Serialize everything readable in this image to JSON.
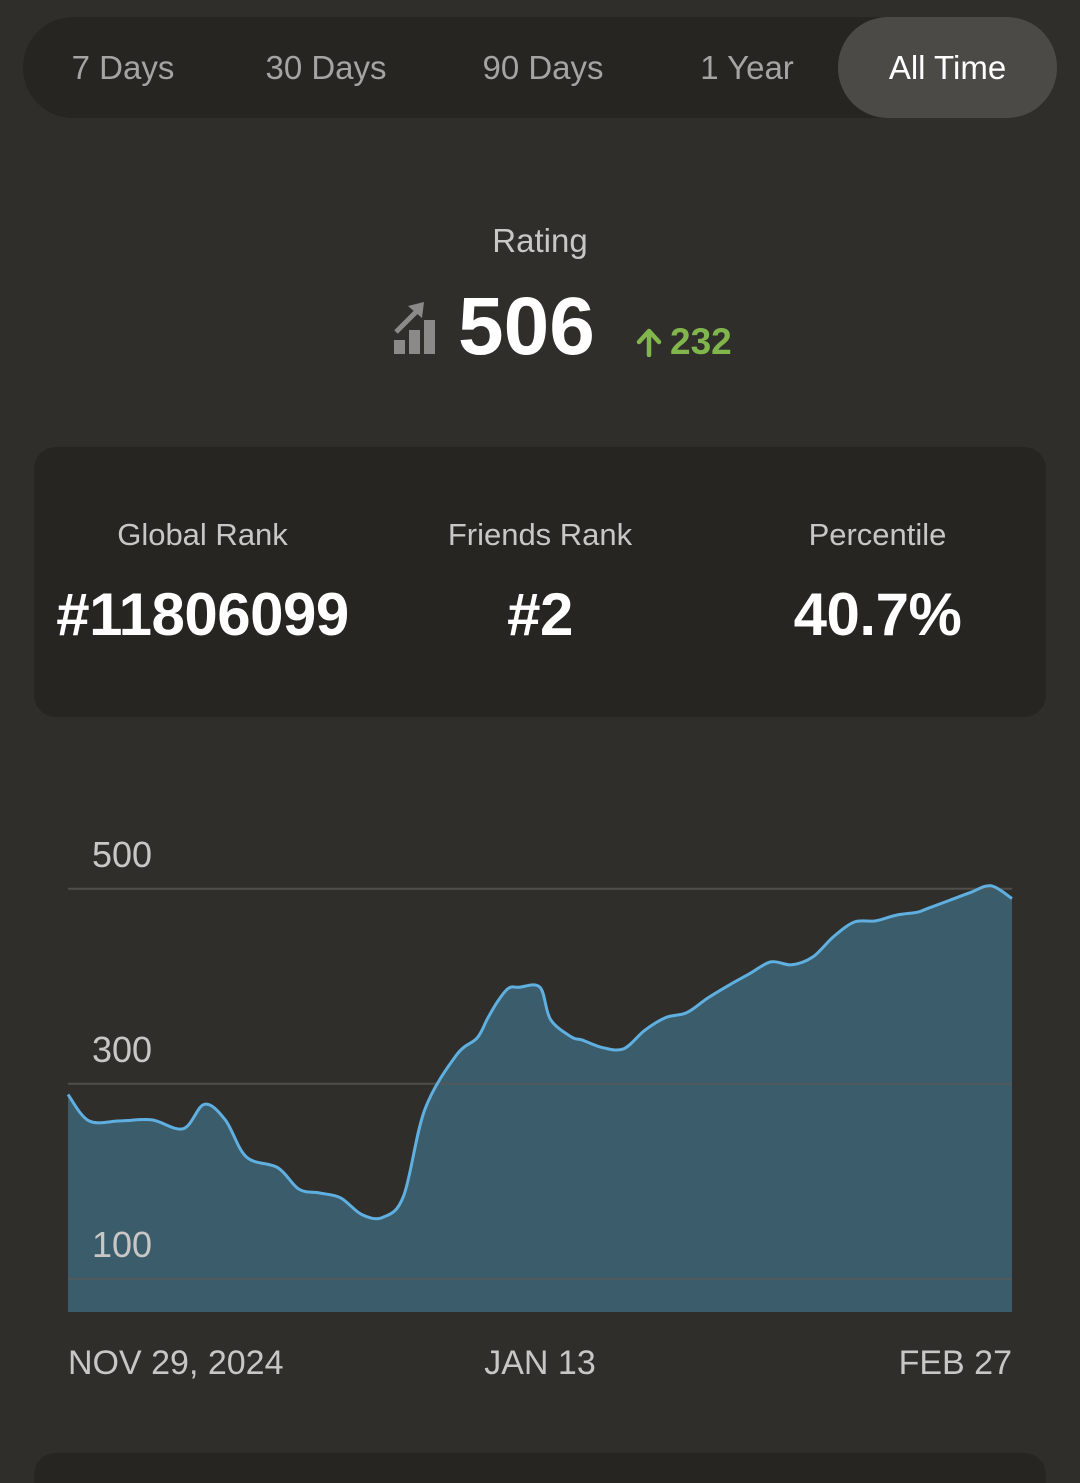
{
  "period_tabs": [
    {
      "label": "7 Days",
      "active": false
    },
    {
      "label": "30 Days",
      "active": false
    },
    {
      "label": "90 Days",
      "active": false
    },
    {
      "label": "1 Year",
      "active": false
    },
    {
      "label": "All Time",
      "active": true
    }
  ],
  "rating": {
    "label": "Rating",
    "value": "506",
    "change": "232",
    "change_direction": "up",
    "icon": "rating-chart-up-icon"
  },
  "stats": {
    "global_rank": {
      "label": "Global Rank",
      "value": "#11806099"
    },
    "friends_rank": {
      "label": "Friends Rank",
      "value": "#2"
    },
    "percentile": {
      "label": "Percentile",
      "value": "40.7%"
    }
  },
  "colors": {
    "background": "#302e2b",
    "card": "#262522",
    "active_tab": "#4b4a46",
    "positive": "#81b64c",
    "line": "#5fb0e0",
    "area": "#3b5c6b"
  },
  "chart_data": {
    "type": "area",
    "x_tick_labels": [
      "NOV 29, 2024",
      "JAN 13",
      "FEB 27"
    ],
    "y_ticks": [
      100,
      300,
      500
    ],
    "ylim": [
      66,
      510
    ],
    "grid": true,
    "x": [
      "2024-11-29",
      "2024-12-01",
      "2024-12-04",
      "2024-12-07",
      "2024-12-10",
      "2024-12-12",
      "2024-12-14",
      "2024-12-16",
      "2024-12-19",
      "2024-12-21",
      "2024-12-23",
      "2024-12-25",
      "2024-12-27",
      "2024-12-29",
      "2024-12-31",
      "2025-01-02",
      "2025-01-05",
      "2025-01-07",
      "2025-01-08",
      "2025-01-09",
      "2025-01-10",
      "2025-01-11",
      "2025-01-13",
      "2025-01-14",
      "2025-01-16",
      "2025-01-17",
      "2025-01-19",
      "2025-01-21",
      "2025-01-23",
      "2025-01-25",
      "2025-01-27",
      "2025-01-29",
      "2025-01-31",
      "2025-02-02",
      "2025-02-04",
      "2025-02-06",
      "2025-02-08",
      "2025-02-10",
      "2025-02-12",
      "2025-02-14",
      "2025-02-16",
      "2025-02-18",
      "2025-02-19",
      "2025-02-21",
      "2025-02-23",
      "2025-02-25",
      "2025-02-27"
    ],
    "values": [
      289,
      262,
      262,
      263,
      254,
      279,
      263,
      225,
      214,
      192,
      188,
      183,
      166,
      163,
      185,
      273,
      329,
      347,
      367,
      385,
      398,
      399,
      399,
      366,
      348,
      345,
      337,
      336,
      355,
      368,
      373,
      388,
      401,
      413,
      425,
      422,
      430,
      451,
      466,
      467,
      473,
      476,
      480,
      488,
      496,
      503,
      490
    ]
  }
}
